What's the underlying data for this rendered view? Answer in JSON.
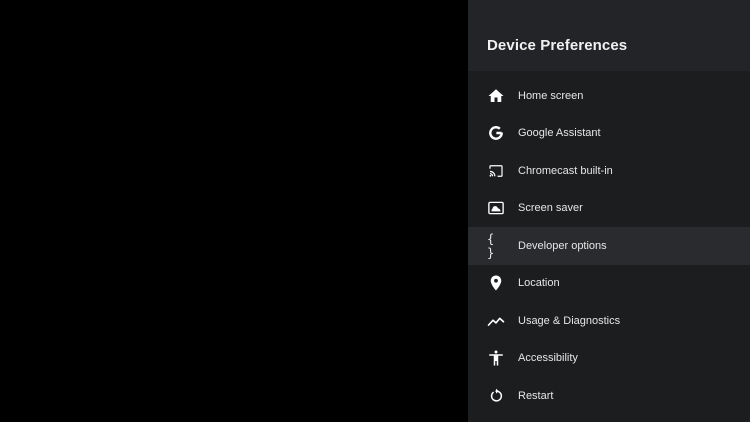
{
  "panel": {
    "title": "Device Preferences",
    "background": "#1c1d1f",
    "header_background": "#232427",
    "focused_item_background": "#2a2b2e"
  },
  "menu": {
    "focused_index": 4,
    "items": [
      {
        "label": "Home screen",
        "icon": "home-icon"
      },
      {
        "label": "Google Assistant",
        "icon": "google-icon"
      },
      {
        "label": "Chromecast built-in",
        "icon": "cast-icon"
      },
      {
        "label": "Screen saver",
        "icon": "screen-saver-icon"
      },
      {
        "label": "Developer options",
        "icon": "braces-icon",
        "icon_text": "{ }"
      },
      {
        "label": "Location",
        "icon": "location-pin-icon"
      },
      {
        "label": "Usage & Diagnostics",
        "icon": "usage-graph-icon"
      },
      {
        "label": "Accessibility",
        "icon": "accessibility-icon"
      },
      {
        "label": "Restart",
        "icon": "restart-icon"
      }
    ]
  }
}
